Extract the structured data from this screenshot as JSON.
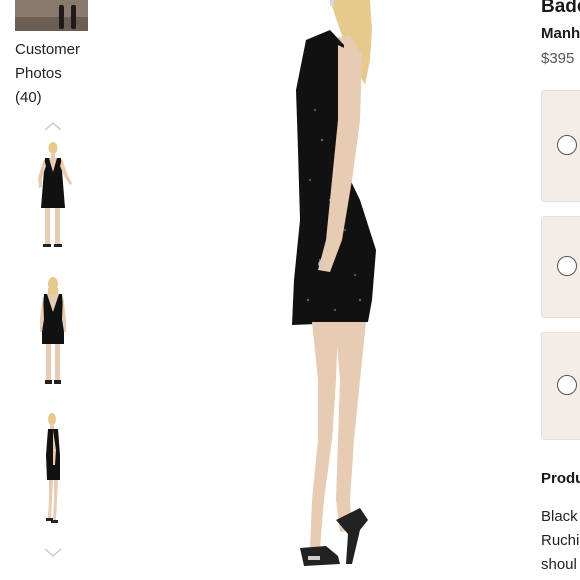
{
  "gallery": {
    "customer_photos_line1": "Customer",
    "customer_photos_line2": "Photos",
    "customer_photos_count": "(40)",
    "thumbnails": [
      {
        "view": "front",
        "label": "front-view-thumbnail"
      },
      {
        "view": "back",
        "label": "back-view-thumbnail"
      },
      {
        "view": "side",
        "label": "side-view-thumbnail"
      }
    ]
  },
  "product": {
    "title": "Bado",
    "designer": "Manh",
    "price": "$395",
    "size_options": [
      {
        "selected": false
      },
      {
        "selected": false
      },
      {
        "selected": false
      }
    ],
    "details_heading": "Produ",
    "details_lines": [
      "Black",
      "Ruchi",
      "shoul"
    ]
  },
  "colors": {
    "option_bg": "#f3ece7",
    "dress": "#111111",
    "skin": "#e8cbb3",
    "hair": "#e6c98c"
  }
}
